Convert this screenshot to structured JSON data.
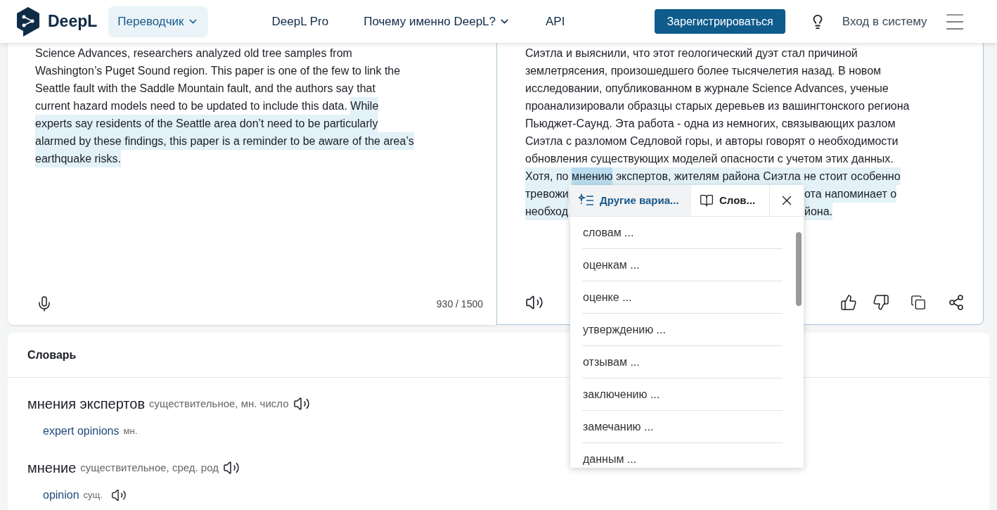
{
  "nav": {
    "brand": "DeepL",
    "product_menu": "Переводчик",
    "links": [
      {
        "label": "DeepL Pro",
        "dropdown": false
      },
      {
        "label": "Почему именно DeepL?",
        "dropdown": true
      },
      {
        "label": "API",
        "dropdown": false
      }
    ],
    "signup": "Зарегистрироваться",
    "login": "Вход в систему"
  },
  "source": {
    "lines": [
      [
        {
          "text": "Science Advances, researchers analyzed old tree samples from",
          "highlighted": false
        }
      ],
      [
        {
          "text": "Washington’s Puget Sound region. This paper is one of the few to link the",
          "highlighted": false
        }
      ],
      [
        {
          "text": "Seattle fault with the Saddle Mountain fault, and the authors say that",
          "highlighted": false
        }
      ],
      [
        {
          "text": "current hazard models need to be updated to include this data. ",
          "highlighted": false
        },
        {
          "text": "While",
          "highlighted": true
        }
      ],
      [
        {
          "text": "experts say residents of the Seattle area don’t need to be particularly",
          "highlighted": true
        }
      ],
      [
        {
          "text": "alarmed by these findings, this paper is a reminder to be aware of the area’s",
          "highlighted": true
        }
      ],
      [
        {
          "text": "earthquake risks.",
          "highlighted": true
        }
      ]
    ],
    "counter": "930 / 1500"
  },
  "target": {
    "lines": [
      [
        {
          "text": "Сиэтла и выяснили, что этот геологический дуэт стал причиной",
          "highlighted": false,
          "focus": false
        }
      ],
      [
        {
          "text": "землетрясения, произошедшего более тысячелетия назад. В новом",
          "highlighted": false,
          "focus": false
        }
      ],
      [
        {
          "text": "исследовании, опубликованном в журнале Science Advances, ученые",
          "highlighted": false,
          "focus": false
        }
      ],
      [
        {
          "text": "проанализировали образцы старых деревьев из вашингтонского региона",
          "highlighted": false,
          "focus": false
        }
      ],
      [
        {
          "text": "Пьюджет-Саунд. Эта работа - одна из немногих, связывающих разлом",
          "highlighted": false,
          "focus": false
        }
      ],
      [
        {
          "text": "Сиэтла с разломом Седловой горы, и авторы говорят о необходимости",
          "highlighted": false,
          "focus": false
        }
      ],
      [
        {
          "text": "обновления существующих моделей опасности с учетом этих данных.",
          "highlighted": false,
          "focus": false
        }
      ],
      [
        {
          "text": "Хотя, по ",
          "highlighted": true,
          "focus": false
        },
        {
          "text": "мнению",
          "highlighted": true,
          "focus": true
        },
        {
          "text": " экспертов, жителям района Сиэтла не стоит особенно",
          "highlighted": true,
          "focus": false
        }
      ],
      [
        {
          "text": "тревожи",
          "highlighted": true,
          "focus": false
        },
        {
          "text": "ота напоминает о",
          "highlighted": true,
          "focus": false,
          "after_popup": true
        }
      ],
      [
        {
          "text": "необход",
          "highlighted": true,
          "focus": false
        },
        {
          "text": "йона.",
          "highlighted": true,
          "focus": false,
          "after_popup": true
        }
      ]
    ]
  },
  "popup": {
    "tabs": [
      {
        "label": "Другие вариа...",
        "selected": true
      },
      {
        "label": "Слов...",
        "selected": false
      }
    ],
    "alternatives": [
      "словам ...",
      "оценкам ...",
      "оценке ...",
      "утверждению ...",
      "отзывам ...",
      "заключению ...",
      "замечанию ...",
      "данным ..."
    ]
  },
  "dictionary": {
    "title": "Словарь",
    "entries": [
      {
        "term": "мнения экспертов",
        "pos": "существительное, мн. число",
        "translations": [
          {
            "text": "expert opinions",
            "tag": "мн.",
            "audio": false
          }
        ]
      },
      {
        "term": "мнение",
        "pos": "существительное, сред. род",
        "translations": [
          {
            "text": "opinion",
            "tag": "сущ.",
            "audio": true
          }
        ]
      }
    ]
  }
}
